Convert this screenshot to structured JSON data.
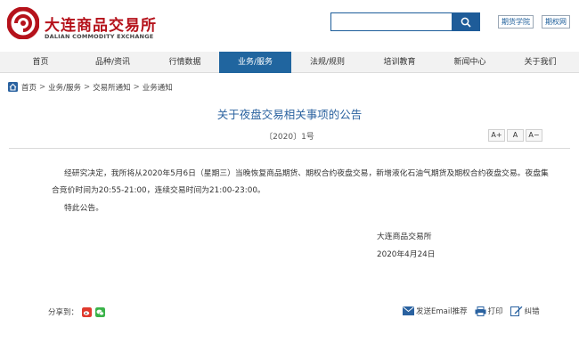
{
  "header": {
    "logo_cn": "大连商品交易所",
    "logo_en": "DALIAN COMMODITY EXCHANGE",
    "search_placeholder": "",
    "links": [
      "期货学院",
      "期权网"
    ]
  },
  "nav": {
    "items": [
      "首页",
      "品种/资讯",
      "行情数据",
      "业务/服务",
      "法规/规则",
      "培训教育",
      "新闻中心",
      "关于我们"
    ],
    "active_index": 3
  },
  "breadcrumb": [
    "首页",
    "业务/服务",
    "交易所通知",
    "业务通知"
  ],
  "article": {
    "title": "关于夜盘交易相关事项的公告",
    "doc_no": "〔2020〕1号",
    "font_buttons": [
      "A+",
      "A",
      "A−"
    ],
    "paragraph1": "经研究决定，我所将从2020年5月6日（星期三）当晚恢复商品期货、期权合约夜盘交易，新增液化石油气期货及期权合约夜盘交易。夜盘集合竞价时间为20:55-21:00，连续交易时间为21:00-23:00。",
    "paragraph2": "特此公告。",
    "signature_org": "大连商品交易所",
    "signature_date": "2020年4月24日"
  },
  "footer": {
    "share_label": "分享到：",
    "email_label": "发送Email推荐",
    "print_label": "打印",
    "error_label": "纠错"
  },
  "colors": {
    "brand_red": "#b5121b",
    "nav_active": "#20659f",
    "title_blue": "#2c63a0"
  }
}
